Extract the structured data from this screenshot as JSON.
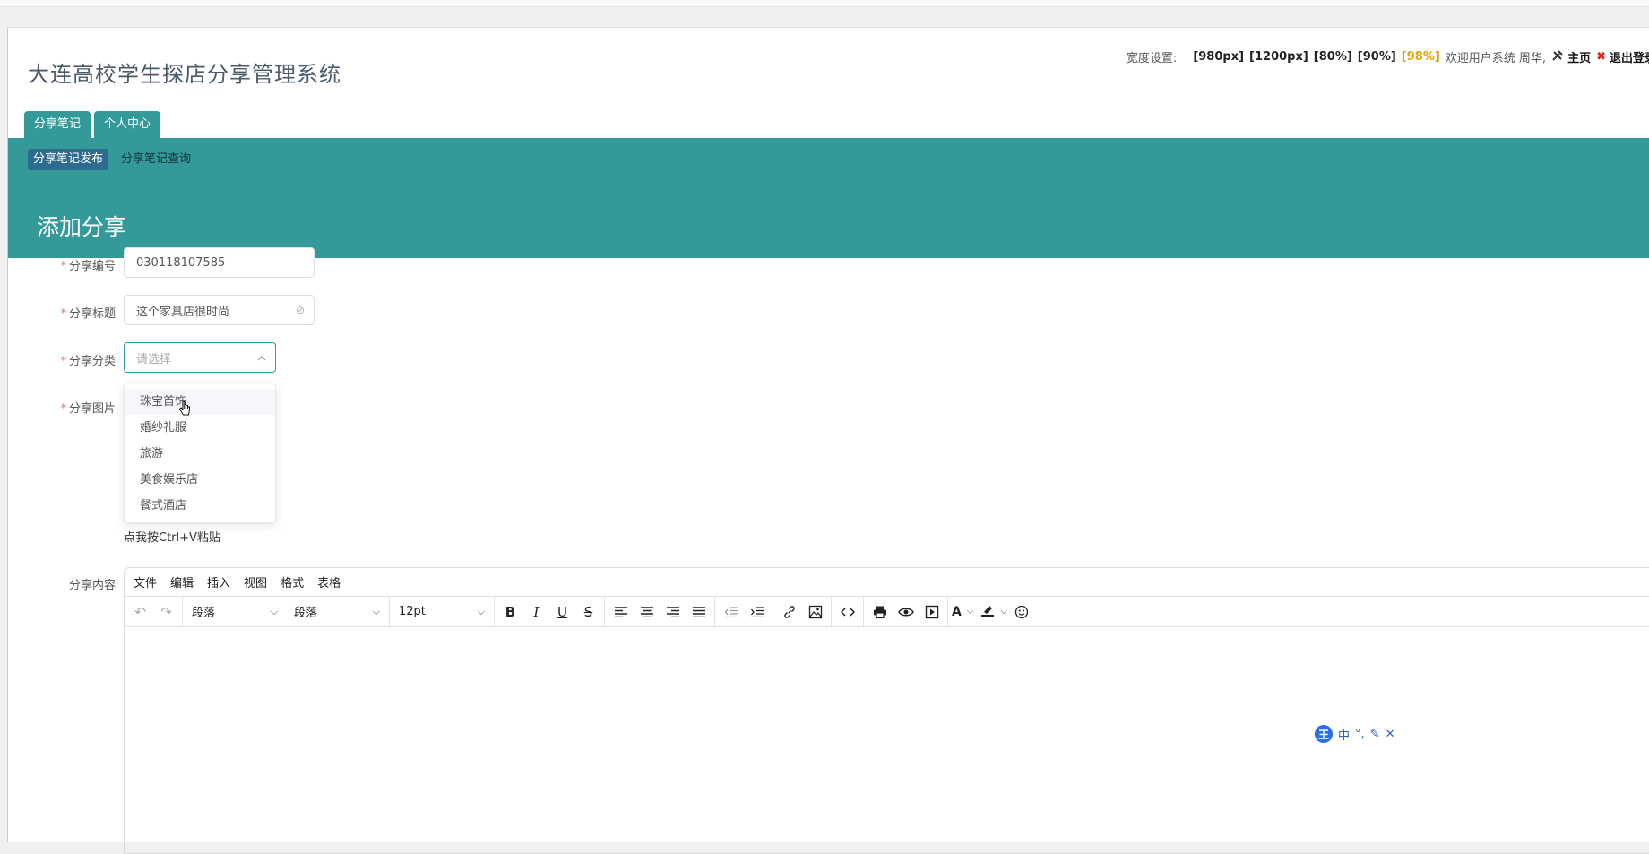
{
  "app": {
    "title": "大连高校学生探店分享管理系统"
  },
  "topbar": {
    "width_label": "宽度设置:",
    "widths": [
      "[980px]",
      "[1200px]",
      "[80%]",
      "[90%]",
      "[98%]"
    ],
    "active_width_index": 4,
    "welcome": "欢迎用户系统 周华,",
    "home_label": "主页",
    "logout_label": "退出登录"
  },
  "tabs": [
    {
      "label": "分享笔记"
    },
    {
      "label": "个人中心"
    }
  ],
  "subnav": [
    {
      "label": "分享笔记发布",
      "active": true
    },
    {
      "label": "分享笔记查询",
      "active": false
    }
  ],
  "page_title": "添加分享",
  "form": {
    "share_no": {
      "label": "分享编号",
      "value": "030118107585"
    },
    "share_title": {
      "label": "分享标题",
      "value": "这个家具店很时尚"
    },
    "share_category": {
      "label": "分享分类",
      "placeholder": "请选择",
      "options": [
        "珠宝首饰",
        "婚纱礼服",
        "旅游",
        "美食娱乐店",
        "餐式酒店"
      ],
      "hovered_index": 0
    },
    "share_image": {
      "label": "分享图片",
      "paste_hint": "点我按Ctrl+V粘贴"
    },
    "share_content": {
      "label": "分享内容"
    }
  },
  "editor": {
    "menus": [
      "文件",
      "编辑",
      "插入",
      "视图",
      "格式",
      "表格"
    ],
    "block_format_1": "段落",
    "block_format_2": "段落",
    "font_size": "12pt"
  },
  "ime": {
    "badge": "王",
    "mode": "中"
  },
  "colors": {
    "accent": "#339999",
    "active_width": "#e5a300",
    "required": "#f56c6c"
  }
}
